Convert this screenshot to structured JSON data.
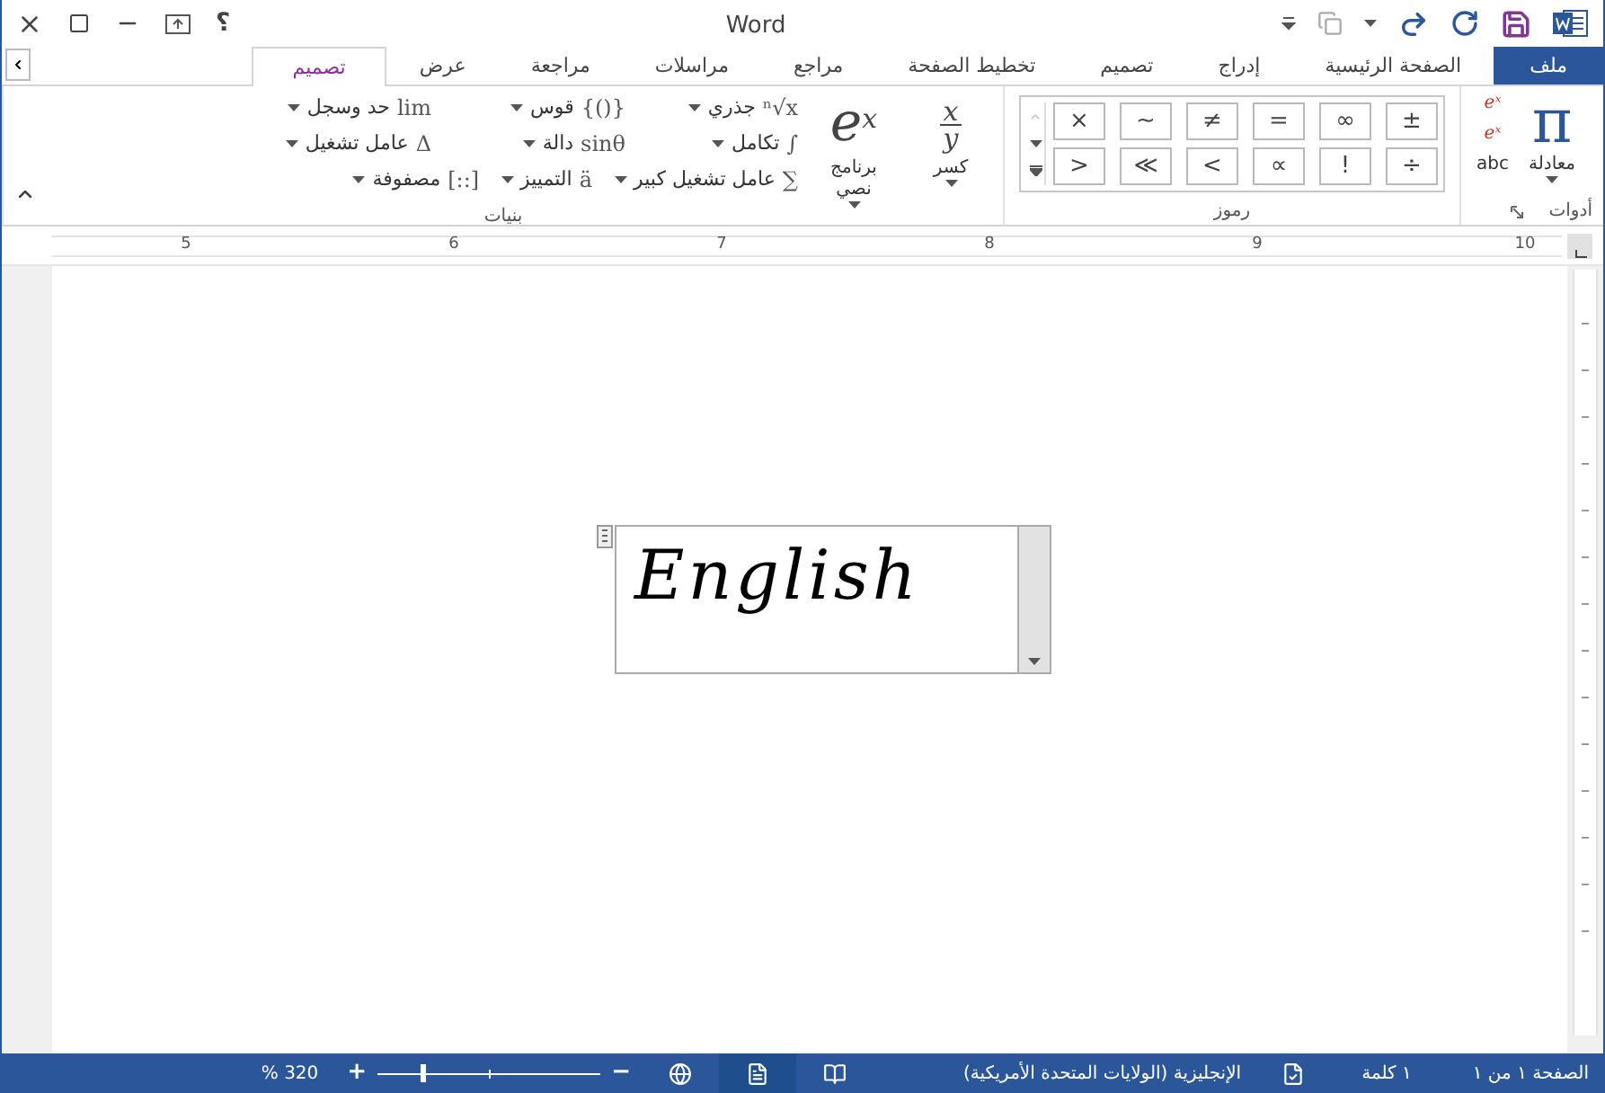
{
  "window": {
    "title": "Word",
    "help": "؟"
  },
  "tabs": [
    {
      "label": "ملف",
      "kind": "file",
      "selected": false
    },
    {
      "label": "الصفحة الرئيسية",
      "kind": "tab",
      "selected": false
    },
    {
      "label": "إدراج",
      "kind": "tab",
      "selected": false
    },
    {
      "label": "تصميم",
      "kind": "tab",
      "selected": false
    },
    {
      "label": "تخطيط الصفحة",
      "kind": "tab",
      "selected": false
    },
    {
      "label": "مراجع",
      "kind": "tab",
      "selected": false
    },
    {
      "label": "مراسلات",
      "kind": "tab",
      "selected": false
    },
    {
      "label": "مراجعة",
      "kind": "tab",
      "selected": false
    },
    {
      "label": "عرض",
      "kind": "tab",
      "selected": false
    },
    {
      "label": "تصميم",
      "kind": "tab",
      "selected": true
    }
  ],
  "ribbon": {
    "tools": {
      "title": "أدوات",
      "equation_glyph": "π",
      "equation_label": "معادلة",
      "small": [
        "eˣ",
        "eˣ",
        "abc"
      ]
    },
    "symbols": {
      "title": "رموز",
      "items": [
        "±",
        "∞",
        "=",
        "≠",
        "∼",
        "×",
        "÷",
        "!",
        "∝",
        "<",
        "≪",
        ">"
      ]
    },
    "structures": {
      "title": "بنيات",
      "large": [
        {
          "kind": "fraction",
          "numerator": "x",
          "denominator": "y",
          "label": "كسر"
        },
        {
          "kind": "script",
          "base": "e",
          "sup": "x",
          "label": "برنامج نصي"
        }
      ],
      "rows": [
        [
          {
            "glyph": "ⁿ√x",
            "label": "جذري"
          },
          {
            "glyph": "{()}",
            "label": "قوس"
          },
          {
            "glyph": "lim",
            "label": "حد وسجل"
          }
        ],
        [
          {
            "glyph": "∫",
            "label": "تكامل"
          },
          {
            "glyph": "sinθ",
            "label": "دالة"
          },
          {
            "glyph": "Δ",
            "label": "عامل تشغيل"
          }
        ],
        [
          {
            "glyph": "∑",
            "label": "عامل تشغيل كبير"
          },
          {
            "glyph": "ä",
            "label": "التمييز"
          },
          {
            "glyph": "[::]",
            "label": "مصفوفة"
          }
        ]
      ]
    }
  },
  "ruler": {
    "numbers": [
      "10",
      "9",
      "8",
      "7",
      "6",
      "5"
    ]
  },
  "document": {
    "equation": "English"
  },
  "status_bar": {
    "page": "الصفحة ١ من ١",
    "words": "١ كلمة",
    "language": "الإنجليزية (الولايات المتحدة الأمريكية)",
    "views": [
      {
        "kind": "read",
        "selected": false
      },
      {
        "kind": "print",
        "selected": true
      },
      {
        "kind": "web",
        "selected": false
      }
    ],
    "zoom_minus": "−",
    "zoom_plus": "+",
    "zoom_reading": "320 %"
  }
}
